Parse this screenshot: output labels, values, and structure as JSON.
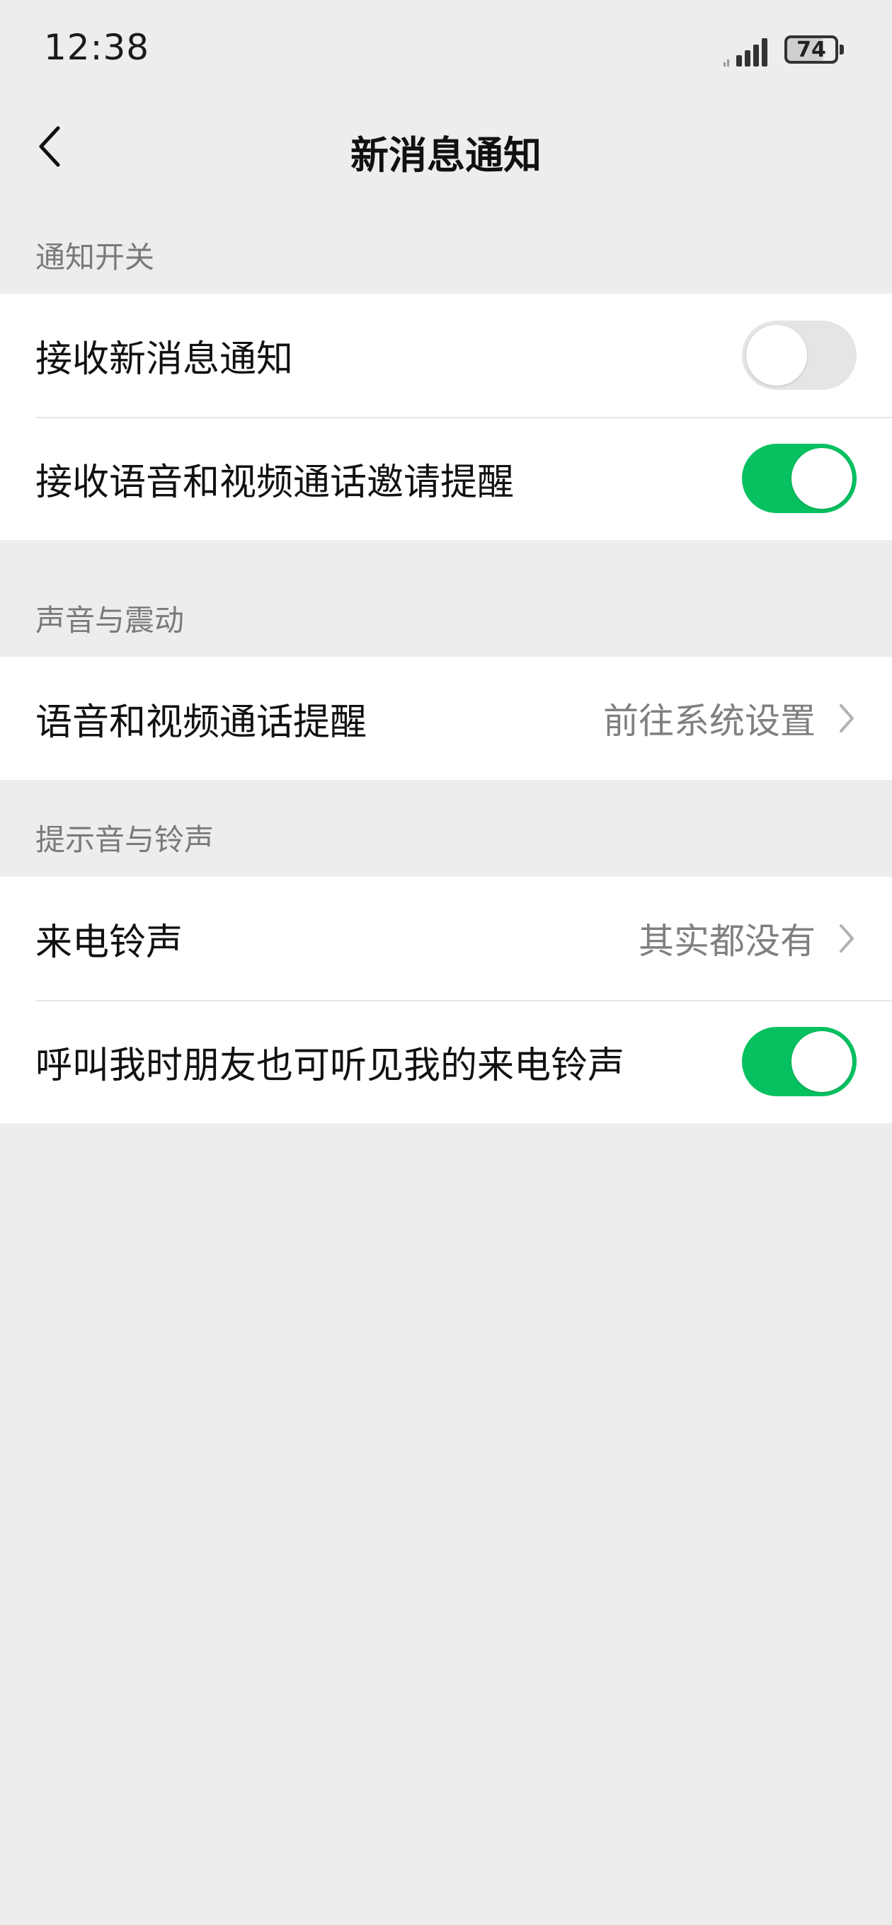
{
  "status_bar": {
    "time": "12:38",
    "battery": "74"
  },
  "nav": {
    "title": "新消息通知"
  },
  "sections": [
    {
      "header": "通知开关",
      "rows": [
        {
          "label": "接收新消息通知",
          "toggle": false
        },
        {
          "label": "接收语音和视频通话邀请提醒",
          "toggle": true
        }
      ]
    },
    {
      "header": "声音与震动",
      "rows": [
        {
          "label": "语音和视频通话提醒",
          "value": "前往系统设置"
        }
      ]
    },
    {
      "header": "提示音与铃声",
      "rows": [
        {
          "label": "来电铃声",
          "value": "其实都没有"
        },
        {
          "label": "呼叫我时朋友也可听见我的来电铃声",
          "toggle": true
        }
      ]
    }
  ],
  "colors": {
    "accent": "#07c160",
    "background": "#ededed",
    "toggle_off": "#e5e5e5"
  },
  "icons": {
    "back": "chevron-left-icon",
    "signal": "signal-icon",
    "battery": "battery-icon",
    "row_arrow": "chevron-right-icon"
  }
}
